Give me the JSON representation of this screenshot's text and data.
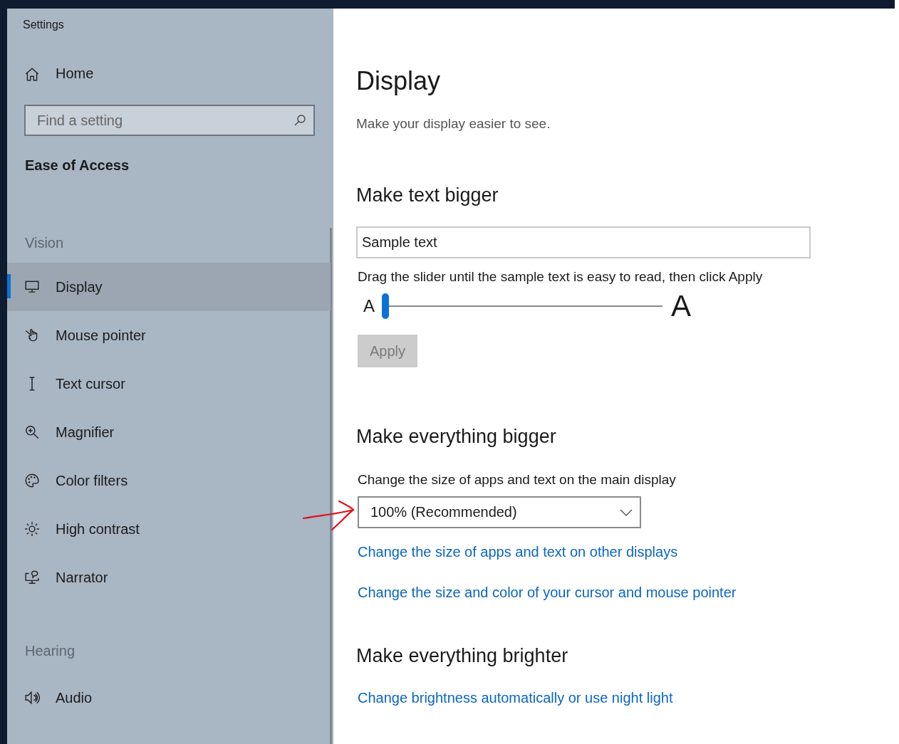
{
  "window": {
    "title": "Settings"
  },
  "sidebar": {
    "home": "Home",
    "search": {
      "placeholder": "Find a setting"
    },
    "category": "Ease of Access",
    "groups": [
      {
        "heading": "Vision",
        "items": [
          {
            "label": "Display",
            "selected": true
          },
          {
            "label": "Mouse pointer",
            "selected": false
          },
          {
            "label": "Text cursor",
            "selected": false
          },
          {
            "label": "Magnifier",
            "selected": false
          },
          {
            "label": "Color filters",
            "selected": false
          },
          {
            "label": "High contrast",
            "selected": false
          },
          {
            "label": "Narrator",
            "selected": false
          }
        ]
      },
      {
        "heading": "Hearing",
        "items": [
          {
            "label": "Audio",
            "selected": false
          }
        ]
      }
    ]
  },
  "page": {
    "title": "Display",
    "subtitle": "Make your display easier to see.",
    "sections": [
      {
        "kind": "text_size",
        "heading": "Make text bigger",
        "sample": "Sample text",
        "hint": "Drag the slider until the sample text is easy to read, then click Apply",
        "small_label": "A",
        "large_label": "A",
        "level": 0,
        "apply": {
          "label": "Apply",
          "disabled": true
        }
      },
      {
        "kind": "scale",
        "heading": "Make everything bigger",
        "label": "Change the size of apps and text on the main display",
        "value": "100% (Recommended)",
        "links": [
          "Change the size of apps and text on other displays",
          "Change the size and color of your cursor and mouse pointer"
        ]
      },
      {
        "kind": "links",
        "heading": "Make everything brighter",
        "links": [
          "Change brightness automatically or use night light"
        ]
      }
    ]
  }
}
